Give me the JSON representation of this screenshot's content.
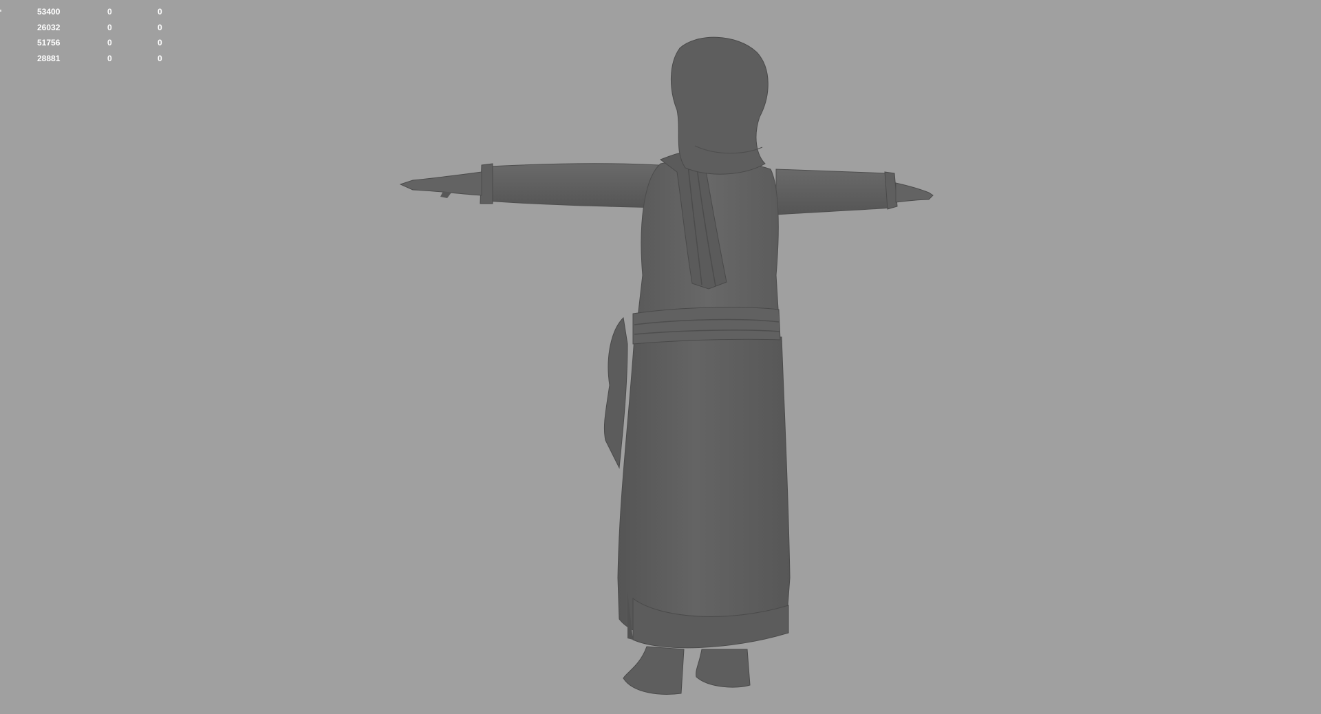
{
  "hud": {
    "rows": [
      {
        "a": "53400",
        "b": "0",
        "c": "0"
      },
      {
        "a": "26032",
        "b": "0",
        "c": "0"
      },
      {
        "a": "51756",
        "b": "0",
        "c": "0"
      },
      {
        "a": "28881",
        "b": "0",
        "c": "0"
      }
    ]
  },
  "colors": {
    "background": "#a0a0a0",
    "model_fill": "#5e5e5e",
    "model_dark": "#4a4a4a",
    "model_light": "#6e6e6e",
    "hud_text": "#ffffff"
  }
}
